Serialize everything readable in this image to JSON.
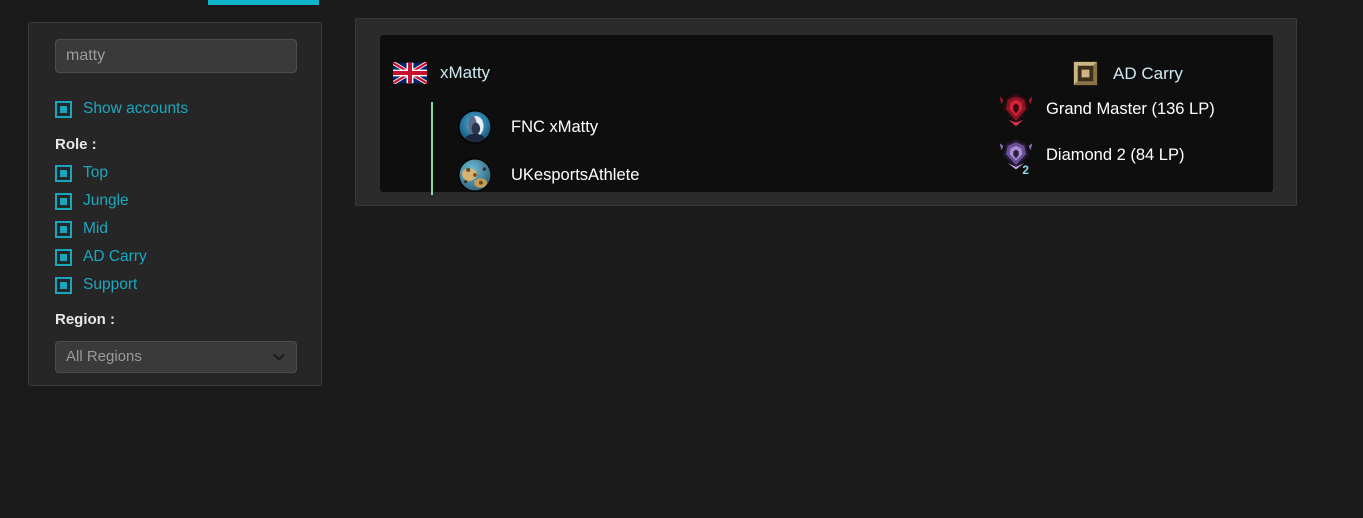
{
  "theme": {
    "page_bg": "#1b1b1b",
    "panel_bg": "#262626",
    "card_bg": "#0e0e0e",
    "accent_cyan": "#17a6bd",
    "tab_cyan": "#10b5cd",
    "link_cyan": "#1aa8c0",
    "name_cyan": "#cfe9f2",
    "connector_green": "#86d9a6",
    "text_white": "#ffffff",
    "text_muted": "#9a9a9a"
  },
  "tabs": {
    "active_indicator_name": "active-tab-indicator"
  },
  "sidebar": {
    "search": {
      "value": "matty",
      "placeholder": "matty"
    },
    "show_accounts": {
      "label": "Show accounts",
      "checked": true,
      "icon": "checkbox-checked-icon"
    },
    "role_heading": "Role :",
    "roles": [
      {
        "label": "Top",
        "checked": true,
        "icon": "checkbox-checked-icon"
      },
      {
        "label": "Jungle",
        "checked": true,
        "icon": "checkbox-checked-icon"
      },
      {
        "label": "Mid",
        "checked": true,
        "icon": "checkbox-checked-icon"
      },
      {
        "label": "AD Carry",
        "checked": true,
        "icon": "checkbox-checked-icon"
      },
      {
        "label": "Support",
        "checked": true,
        "icon": "checkbox-checked-icon"
      }
    ],
    "region_heading": "Region :",
    "region_select": {
      "selected": "All Regions",
      "options": [
        "All Regions"
      ],
      "icon": "chevron-down-icon"
    }
  },
  "results": [
    {
      "player_name": "xMatty",
      "country_icon": "uk-flag-icon",
      "role_label": "AD Carry",
      "role_icon": "bottom-lane-icon",
      "accounts": [
        {
          "name": "FNC xMatty",
          "avatar_icon": "summoner-avatar-icon",
          "rank_label": "Grand Master (136 LP)",
          "rank_tier": "Grand Master",
          "rank_lp": "136 LP",
          "rank_icon": "grandmaster-emblem-icon",
          "rank_division": ""
        },
        {
          "name": "UKesportsAthlete",
          "avatar_icon": "summoner-avatar-icon",
          "rank_label": "Diamond 2 (84 LP)",
          "rank_tier": "Diamond 2",
          "rank_lp": "84 LP",
          "rank_icon": "diamond-emblem-icon",
          "rank_division": "2"
        }
      ]
    }
  ]
}
